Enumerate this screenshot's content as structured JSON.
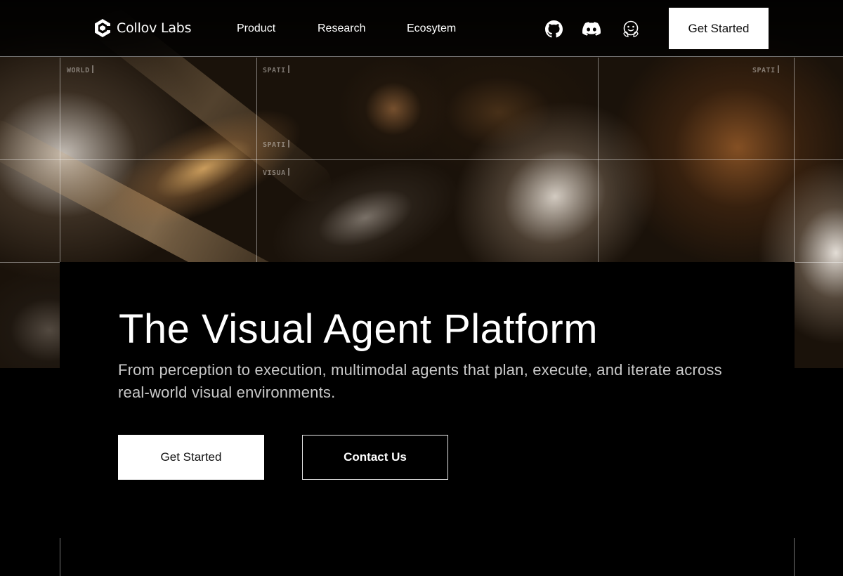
{
  "brand": {
    "name": "Collov Labs",
    "logo_icon": "collov-logo-icon"
  },
  "nav": {
    "links": [
      "Product",
      "Research",
      "Ecosytem"
    ],
    "icons": [
      "github-icon",
      "discord-icon",
      "huggingface-icon"
    ],
    "cta": "Get Started"
  },
  "grid_tags": {
    "cell_1": "WORLD",
    "cell_2": "SPATI",
    "cell_3": "SPATI",
    "cell_4": "VISUA",
    "cell_5": "SPATI"
  },
  "hero": {
    "title": "The Visual Agent Platform",
    "subtitle": "From perception to execution, multimodal agents that plan, execute, and iterate across real-world visual environments.",
    "primary_cta": "Get Started",
    "secondary_cta": "Contact Us"
  },
  "colors": {
    "background": "#000000",
    "text": "#ffffff",
    "muted_text": "#c9c9c9",
    "button_bg": "#ffffff"
  }
}
